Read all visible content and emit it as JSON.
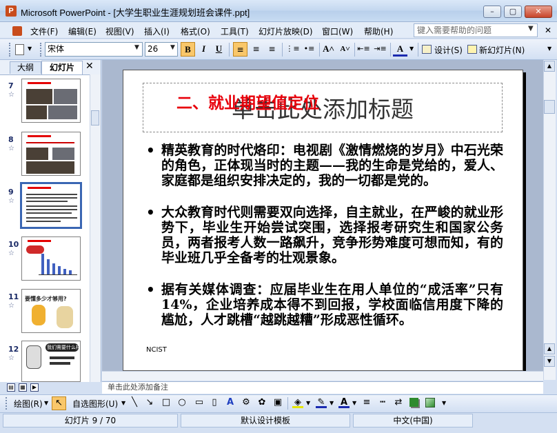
{
  "window": {
    "title": "Microsoft PowerPoint - [大学生职业生涯规划班会课件.ppt]",
    "app_icon_letter": "P"
  },
  "menu": {
    "items": [
      "文件(F)",
      "编辑(E)",
      "视图(V)",
      "插入(I)",
      "格式(O)",
      "工具(T)",
      "幻灯片放映(D)",
      "窗口(W)",
      "帮助(H)"
    ],
    "help_placeholder": "键入需要帮助的问题"
  },
  "format_toolbar": {
    "font_name": "宋体",
    "font_size": "26",
    "bold": "B",
    "italic": "I",
    "underline": "U",
    "design_label": "设计(S)",
    "new_slide_label": "新幻灯片(N)",
    "bold_active": true
  },
  "left_pane": {
    "tab_outline": "大纲",
    "tab_slides": "幻灯片",
    "close": "✕",
    "slides": [
      {
        "num": "7"
      },
      {
        "num": "8"
      },
      {
        "num": "9"
      },
      {
        "num": "10"
      },
      {
        "num": "11",
        "texts": [
          "要懂多少才够用?"
        ]
      },
      {
        "num": "12",
        "texts": [
          "我们需要什么样?"
        ]
      }
    ],
    "selected_slide": "9"
  },
  "slide": {
    "placeholder": "单击此处添加标题",
    "heading": "二、就业期望值定位",
    "bullets": [
      "精英教育的时代烙印：电视剧《激情燃烧的岁月》中石光荣的角色，正体现当时的主题——我的生命是党给的，爱人、家庭都是组织安排决定的，我的一切都是党的。",
      "大众教育时代则需要双向选择，自主就业，在严峻的就业形势下，毕业生开始尝试突围，选择报考研究生和国家公务员，两者报考人数一路飙升，竞争形势难度可想而知，有的毕业班几乎全备考的壮观景象。",
      "据有关媒体调查：应届毕业生在用人单位的“成活率”只有14%，企业培养成本得不到回报，学校面临信用度下降的尴尬，人才跳槽“越跳越糟”形成恶性循环。"
    ],
    "footer": "NCIST"
  },
  "notes": {
    "text": "单击此处添加备注"
  },
  "draw_toolbar": {
    "draw_label": "绘图(R)",
    "autoshape_label": "自选图形(U)"
  },
  "status": {
    "slide_info": "幻灯片 9 / 70",
    "template": "默认设计模板",
    "language": "中文(中国)"
  }
}
